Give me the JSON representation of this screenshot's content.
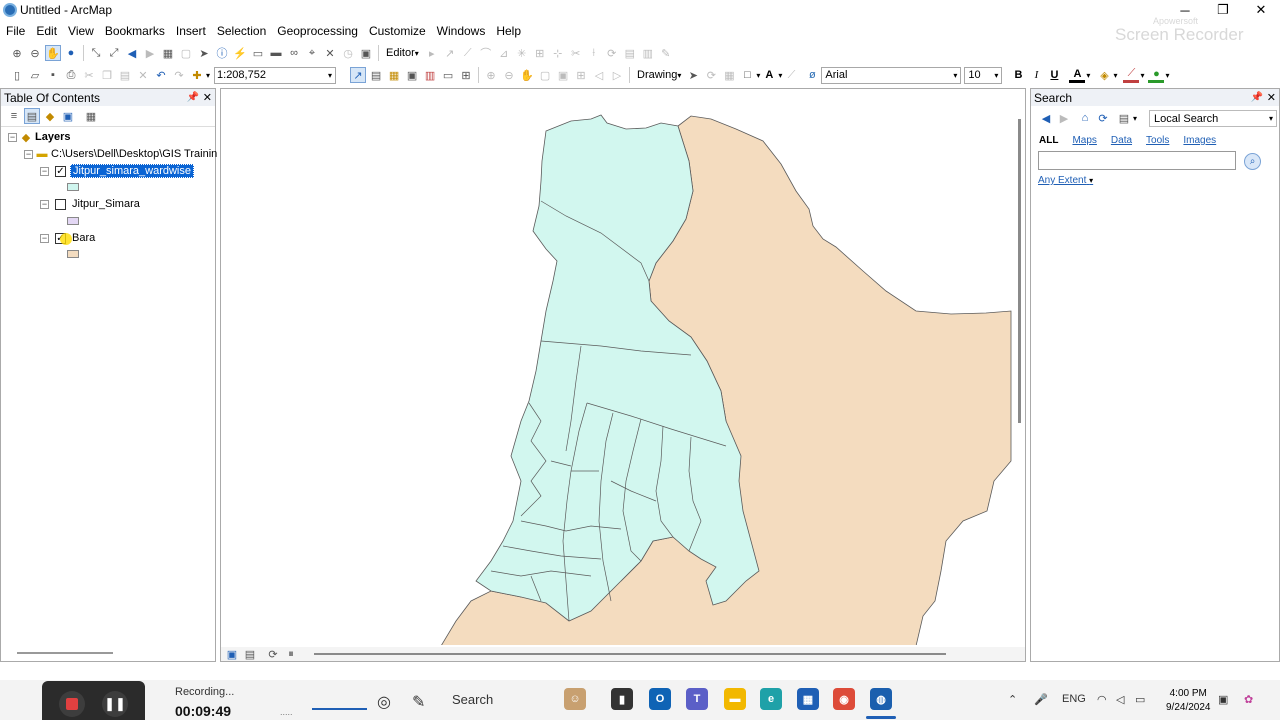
{
  "window": {
    "title": "Untitled - ArcMap",
    "minimize": "─",
    "maximize": "❐",
    "close": "✕"
  },
  "watermark": {
    "line1": "Screen Recorder",
    "line2": "Apowersoft"
  },
  "menu": [
    "File",
    "Edit",
    "View",
    "Bookmarks",
    "Insert",
    "Selection",
    "Geoprocessing",
    "Customize",
    "Windows",
    "Help"
  ],
  "toolbar": {
    "editor_label": "Editor",
    "scale_value": "1:208,752",
    "drawing_label": "Drawing",
    "font_name": "Arial",
    "font_size": "10",
    "bold": "B",
    "italic": "I",
    "underline": "U"
  },
  "toc": {
    "title": "Table Of Contents",
    "root_label": "Layers",
    "folder_path": "C:\\Users\\Dell\\Desktop\\GIS Trainin",
    "layers": [
      {
        "name": "Jitpur_simara_wardwise",
        "checked": true,
        "selected": true,
        "swatch": "#cff5ee"
      },
      {
        "name": "Jitpur_Simara",
        "checked": false,
        "selected": false,
        "swatch": "#e3d7f4"
      },
      {
        "name": "Bara",
        "checked": true,
        "selected": false,
        "swatch": "#f3dcc0"
      }
    ]
  },
  "map": {
    "ward_fill": "#d2f7ef",
    "district_fill": "#f4dcbf",
    "outline": "#5a5a5a"
  },
  "search": {
    "title": "Search",
    "scope": "Local Search",
    "filters": [
      "ALL",
      "Maps",
      "Data",
      "Tools",
      "Images"
    ],
    "query": "",
    "extent_label": "Any Extent"
  },
  "recorder": {
    "status": "Recording...",
    "elapsed": "00:09:49"
  },
  "taskbar": {
    "search_placeholder": "Search",
    "language": "ENG",
    "time": "4:00 PM",
    "date": "9/24/2024"
  }
}
